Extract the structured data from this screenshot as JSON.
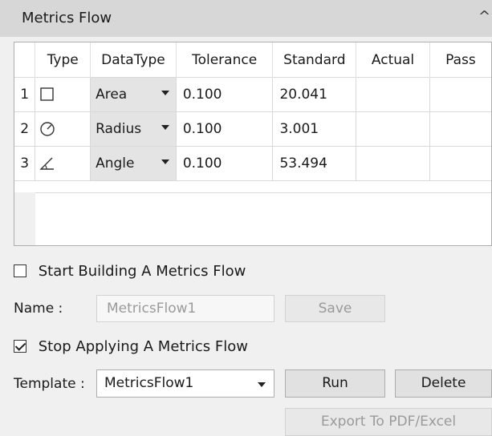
{
  "panel": {
    "title": "Metrics Flow",
    "collapse_glyph": "^"
  },
  "table": {
    "columns": [
      "Type",
      "DataType",
      "Tolerance",
      "Standard",
      "Actual",
      "Pass"
    ],
    "rows": [
      {
        "index": "1",
        "type_icon": "square-icon",
        "datatype": "Area",
        "tolerance": "0.100",
        "standard": "20.041",
        "actual": "",
        "pass": ""
      },
      {
        "index": "2",
        "type_icon": "circle-radius-icon",
        "datatype": "Radius",
        "tolerance": "0.100",
        "standard": "3.001",
        "actual": "",
        "pass": ""
      },
      {
        "index": "3",
        "type_icon": "angle-icon",
        "datatype": "Angle",
        "tolerance": "0.100",
        "standard": "53.494",
        "actual": "",
        "pass": ""
      }
    ]
  },
  "build": {
    "checkbox_label": "Start Building A Metrics Flow",
    "checked": false,
    "name_label": "Name :",
    "name_value": "MetricsFlow1",
    "save_label": "Save"
  },
  "apply": {
    "checkbox_label": "Stop Applying A Metrics Flow",
    "checked": true,
    "template_label": "Template :",
    "template_value": "MetricsFlow1",
    "run_label": "Run",
    "delete_label": "Delete",
    "export_label": "Export To PDF/Excel"
  }
}
